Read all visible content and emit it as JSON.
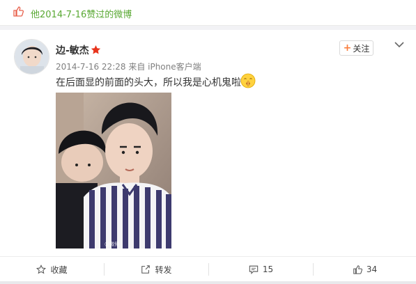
{
  "liked_header": {
    "text": "他2014-7-16赞过的微博",
    "icon": "thumbs-up-icon",
    "color": "#58a832"
  },
  "post": {
    "author": {
      "name": "边-敏杰",
      "badge": "star-icon",
      "avatar": "avatar"
    },
    "meta": "2014-7-16 22:28 来自 iPhone客户端",
    "follow_label": "关注",
    "text": "在后面显的前面的头大，所以我是心机鬼啦",
    "emoji": "shh-emoji-icon",
    "photo": {
      "watermark": "@微博"
    }
  },
  "actions": [
    {
      "name": "favorite",
      "label": "收藏",
      "icon": "star-outline-icon"
    },
    {
      "name": "repost",
      "label": "转发",
      "icon": "repost-icon"
    },
    {
      "name": "comment",
      "label": "15",
      "icon": "comment-icon"
    },
    {
      "name": "like",
      "label": "34",
      "icon": "thumbs-up-icon"
    }
  ],
  "colors": {
    "accent": "#fa7d3c",
    "link_green": "#58a832",
    "meta_gray": "#808080"
  }
}
